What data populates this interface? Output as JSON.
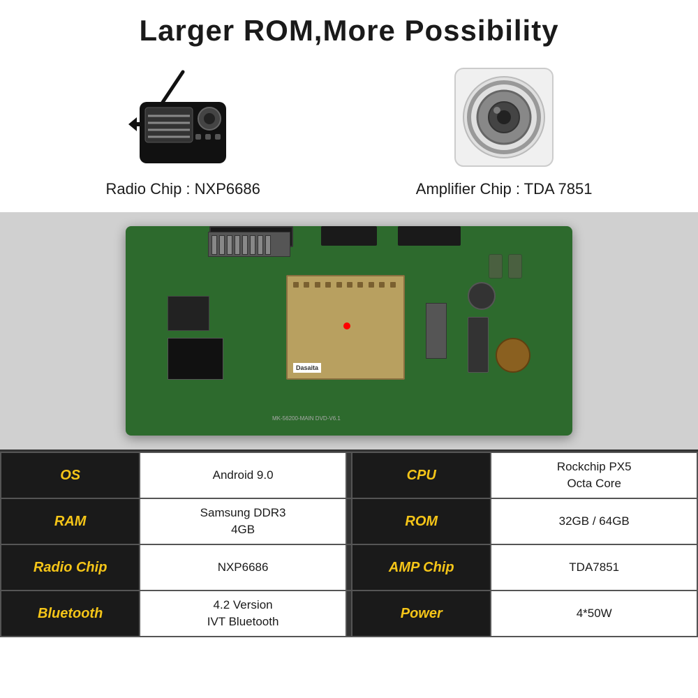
{
  "header": {
    "title": "Larger ROM,More Possibility"
  },
  "radio": {
    "label": "Radio Chip : NXP6686"
  },
  "amplifier": {
    "label": "Amplifier Chip : TDA 7851"
  },
  "specs": [
    {
      "left_label": "OS",
      "left_value": "Android 9.0",
      "right_label": "CPU",
      "right_value": "Rockchip PX5\nOcta Core"
    },
    {
      "left_label": "RAM",
      "left_value": "Samsung DDR3\n4GB",
      "right_label": "ROM",
      "right_value": "32GB / 64GB"
    },
    {
      "left_label": "Radio Chip",
      "left_value": "NXP6686",
      "right_label": "AMP Chip",
      "right_value": "TDA7851"
    },
    {
      "left_label": "Bluetooth",
      "left_value": "4.2 Version\nIVT Bluetooth",
      "right_label": "Power",
      "right_value": "4*50W"
    }
  ],
  "colors": {
    "label_bg": "#1a1a1a",
    "label_text": "#f5c518",
    "value_bg": "#ffffff",
    "border": "#555555"
  }
}
